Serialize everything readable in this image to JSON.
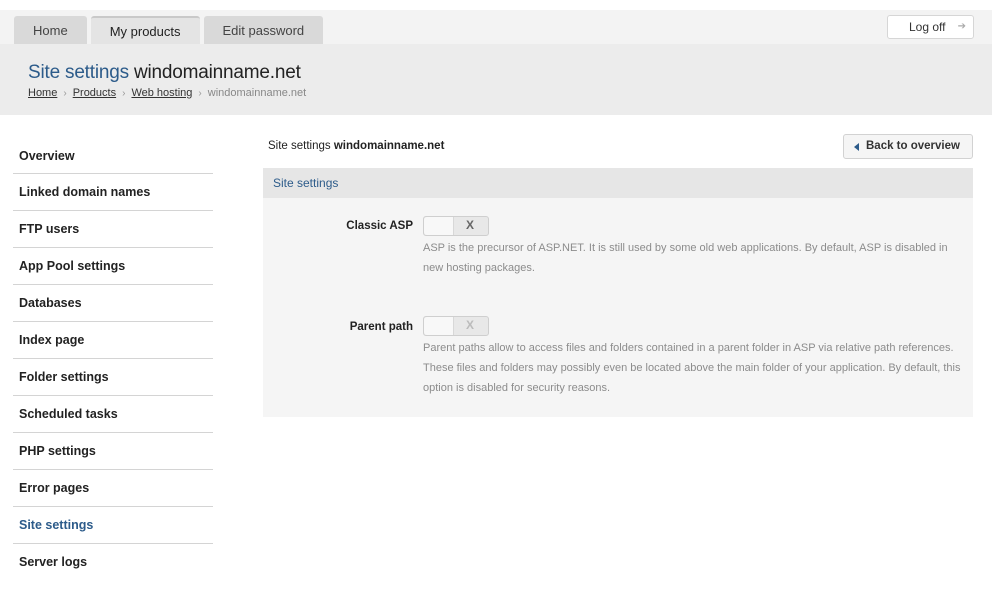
{
  "tabs": [
    {
      "label": "Home",
      "active": false
    },
    {
      "label": "My products",
      "active": true
    },
    {
      "label": "Edit password",
      "active": false
    }
  ],
  "logoff_label": "Log off",
  "header": {
    "title_prefix": "Site settings",
    "title_domain": "windomainname.net"
  },
  "breadcrumb": [
    "Home",
    "Products",
    "Web hosting",
    "windomainname.net"
  ],
  "sidebar": {
    "items": [
      {
        "label": "Overview",
        "active": false
      },
      {
        "label": "Linked domain names",
        "active": false
      },
      {
        "label": "FTP users",
        "active": false
      },
      {
        "label": "App Pool settings",
        "active": false
      },
      {
        "label": "Databases",
        "active": false
      },
      {
        "label": "Index page",
        "active": false
      },
      {
        "label": "Folder settings",
        "active": false
      },
      {
        "label": "Scheduled tasks",
        "active": false
      },
      {
        "label": "PHP settings",
        "active": false
      },
      {
        "label": "Error pages",
        "active": false
      },
      {
        "label": "Site settings",
        "active": true
      },
      {
        "label": "Server logs",
        "active": false
      }
    ]
  },
  "content": {
    "title_prefix": "Site settings",
    "title_domain": "windomainname.net",
    "back_label": "Back to overview"
  },
  "panel": {
    "header": "Site settings",
    "settings": [
      {
        "label": "Classic ASP",
        "toggle_text": "X",
        "enabled": false,
        "description": "ASP is the precursor of ASP.NET. It is still used by some old web applications. By default, ASP is disabled in new hosting packages."
      },
      {
        "label": "Parent path",
        "toggle_text": "X",
        "enabled": false,
        "description": "Parent paths allow to access files and folders contained in a parent folder in ASP via relative path references. These files and folders may possibly even be located above the main folder of your application. By default, this option is disabled for security reasons."
      }
    ]
  },
  "colors": {
    "accent": "#2c5b8a",
    "header_bg": "#ececec",
    "panel_bg": "#f5f5f5"
  }
}
